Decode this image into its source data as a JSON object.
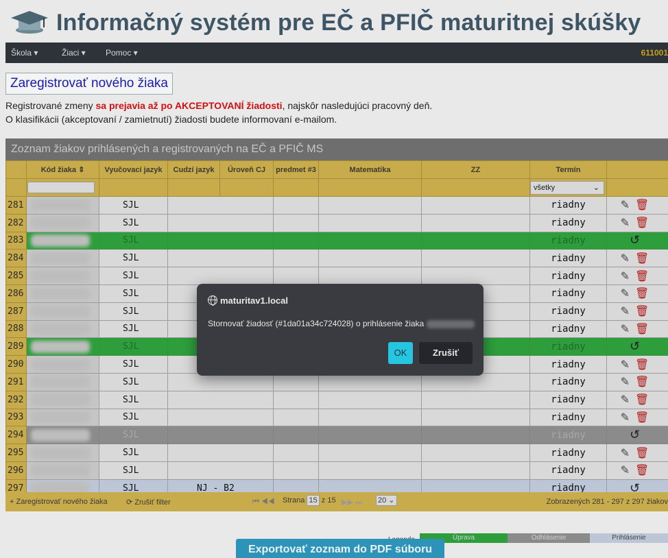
{
  "app": {
    "title": "Informačný systém pre EČ a PFIČ maturitnej skúšky",
    "school_code": "611001"
  },
  "menu": [
    {
      "label": "Škola ▾"
    },
    {
      "label": "Žiaci ▾"
    },
    {
      "label": "Pomoc ▾"
    }
  ],
  "register_button": "Zaregistrovať nového žiaka",
  "info": {
    "line1_pre": "Registrované zmeny ",
    "line1_bold": "sa prejavia až po AKCEPTOVANÍ žiadosti",
    "line1_post": ", najskôr nasledujúci pracovný deň.",
    "line2": "O klasifikácii (akceptovaní / zamietnutí) žiadosti budete informovaní e-mailom."
  },
  "panel_title": "Zoznam žiakov prihlásených a registrovaných na EČ a PFIČ MS",
  "columns": [
    "",
    "Kód žiaka ⇕",
    "Vyučovací jazyk",
    "Cudzí jazyk",
    "Úroveň CJ",
    "predmet #3",
    "Matematika",
    "ZZ",
    "Termín",
    ""
  ],
  "filter": {
    "termin": "všetky"
  },
  "rows": [
    {
      "num": "281",
      "lang": "SJL",
      "cudzi": "",
      "termin": "riadny",
      "state": "normal"
    },
    {
      "num": "282",
      "lang": "SJL",
      "cudzi": "",
      "termin": "riadny",
      "state": "normal"
    },
    {
      "num": "283",
      "lang": "SJL",
      "cudzi": "",
      "termin": "riadny",
      "state": "green"
    },
    {
      "num": "284",
      "lang": "SJL",
      "cudzi": "",
      "termin": "riadny",
      "state": "normal"
    },
    {
      "num": "285",
      "lang": "SJL",
      "cudzi": "",
      "termin": "riadny",
      "state": "normal"
    },
    {
      "num": "286",
      "lang": "SJL",
      "cudzi": "",
      "termin": "riadny",
      "state": "normal"
    },
    {
      "num": "287",
      "lang": "SJL",
      "cudzi": "",
      "termin": "riadny",
      "state": "normal"
    },
    {
      "num": "288",
      "lang": "SJL",
      "cudzi": "",
      "termin": "riadny",
      "state": "normal"
    },
    {
      "num": "289",
      "lang": "SJL",
      "cudzi": "",
      "termin": "riadny",
      "state": "green"
    },
    {
      "num": "290",
      "lang": "SJL",
      "cudzi": "",
      "termin": "riadny",
      "state": "normal"
    },
    {
      "num": "291",
      "lang": "SJL",
      "cudzi": "",
      "termin": "riadny",
      "state": "normal"
    },
    {
      "num": "292",
      "lang": "SJL",
      "cudzi": "",
      "termin": "riadny",
      "state": "normal"
    },
    {
      "num": "293",
      "lang": "SJL",
      "cudzi": "",
      "termin": "riadny",
      "state": "normal"
    },
    {
      "num": "294",
      "lang": "SJL",
      "cudzi": "",
      "termin": "riadny",
      "state": "grey"
    },
    {
      "num": "295",
      "lang": "SJL",
      "cudzi": "",
      "termin": "riadny",
      "state": "normal"
    },
    {
      "num": "296",
      "lang": "SJL",
      "cudzi": "",
      "termin": "riadny",
      "state": "normal"
    },
    {
      "num": "297",
      "lang": "SJL",
      "cudzi": "NJ - B2",
      "termin": "riadny",
      "state": "blue"
    }
  ],
  "pager": {
    "add": "+ Zaregistrovať nového žiaka",
    "clear": "⟳ Zrušiť filter",
    "nav_first": "⏮ ◀◀",
    "strana": "Strana",
    "page": "15",
    "of": "z 15",
    "nav_last": "▶▶ ⏭",
    "per_page": "20 ⌄",
    "summary": "Zobrazených 281 - 297 z 297 žiakov"
  },
  "legend": {
    "label": "Legenda",
    "items": [
      {
        "label": "Úprava",
        "color": "#2e9e3c"
      },
      {
        "label": "Odhlásenie",
        "color": "#8b8b8b"
      },
      {
        "label": "Prihlásenie",
        "color": "#bdc6d6"
      }
    ]
  },
  "export_button": "Exportovať zoznam do PDF súboru",
  "dialog": {
    "host": "maturitav1.local",
    "message": "Stornovať žiadosť (#1da01a34c724028) o prihlásenie žiaka",
    "ok": "OK",
    "cancel": "Zrušiť"
  },
  "icons": {
    "edit": "pencil-icon",
    "delete": "trash-icon",
    "revert": "undo-icon"
  }
}
